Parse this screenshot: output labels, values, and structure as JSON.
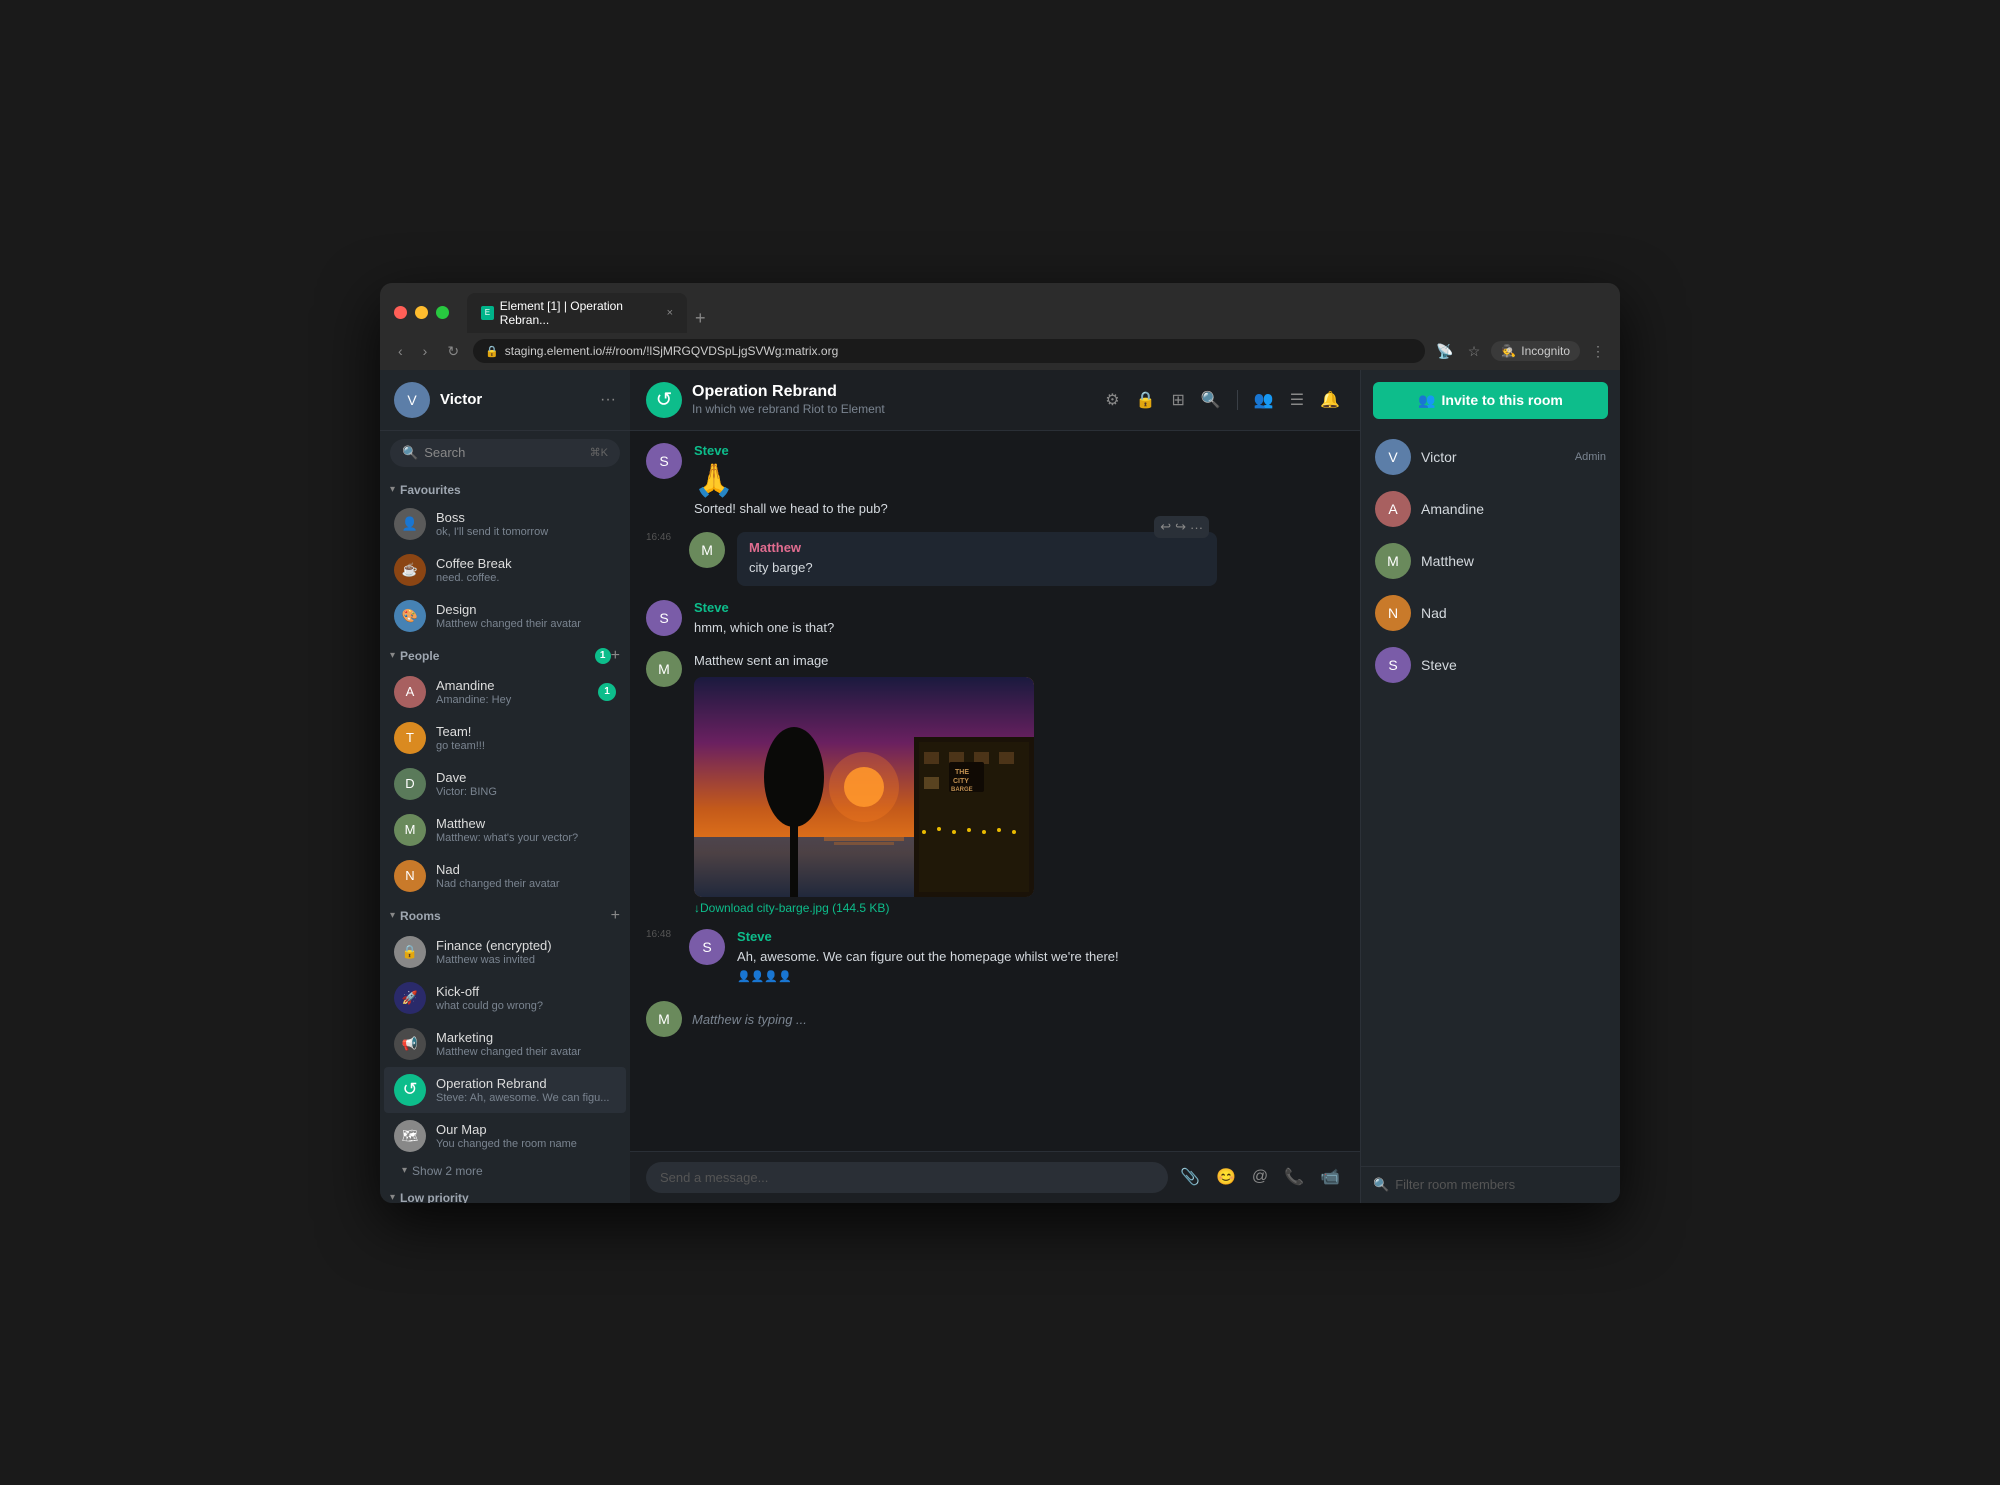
{
  "browser": {
    "tab_label": "Element [1] | Operation Rebran...",
    "tab_close": "×",
    "tab_new": "+",
    "nav_back": "‹",
    "nav_forward": "›",
    "nav_refresh": "↻",
    "address": "staging.element.io/#/room/!lSjMRGQVDSpLjgSVWg:matrix.org",
    "incognito_label": "Incognito",
    "incognito_icon": "🕵"
  },
  "sidebar": {
    "user_name": "Victor",
    "search_placeholder": "Search",
    "search_kbd": "⌘K",
    "sections": {
      "favourites_label": "Favourites",
      "people_label": "People",
      "rooms_label": "Rooms",
      "low_priority_label": "Low priority"
    },
    "favourites": [
      {
        "id": "boss",
        "name": "Boss",
        "preview": "ok, I'll send it tomorrow",
        "avatar_color": "av-boss"
      },
      {
        "id": "coffee-break",
        "name": "Coffee Break",
        "preview": "need. coffee.",
        "avatar_color": "av-coffee"
      },
      {
        "id": "design",
        "name": "Design",
        "preview": "Matthew changed their avatar",
        "avatar_color": "av-design"
      }
    ],
    "people": [
      {
        "id": "amandine",
        "name": "Amandine",
        "preview": "Amandine: Hey",
        "badge": "1",
        "avatar_color": "av-amandine"
      },
      {
        "id": "team",
        "name": "Team!",
        "preview": "go team!!!",
        "avatar_color": "av-team"
      },
      {
        "id": "dave",
        "name": "Dave",
        "preview": "Victor: BING",
        "avatar_color": "av-dave"
      },
      {
        "id": "matthew",
        "name": "Matthew",
        "preview": "Matthew: what's your vector?",
        "avatar_color": "av-matthew"
      },
      {
        "id": "nad",
        "name": "Nad",
        "preview": "Nad changed their avatar",
        "avatar_color": "av-nad"
      }
    ],
    "rooms": [
      {
        "id": "finance",
        "name": "Finance (encrypted)",
        "preview": "Matthew was invited",
        "avatar_color": "av-finance"
      },
      {
        "id": "kickoff",
        "name": "Kick-off",
        "preview": "what could go wrong?",
        "avatar_color": "av-kickoff"
      },
      {
        "id": "marketing",
        "name": "Marketing",
        "preview": "Matthew changed their avatar",
        "avatar_color": "av-marketing"
      },
      {
        "id": "operation-rebrand",
        "name": "Operation Rebrand",
        "preview": "Steve: Ah, awesome. We can figu...",
        "avatar_color": "av-oprebrand",
        "active": true
      },
      {
        "id": "our-map",
        "name": "Our Map",
        "preview": "You changed the room name",
        "avatar_color": "av-ourmap"
      }
    ],
    "show_more_label": "Show 2 more"
  },
  "chat": {
    "room_name": "Operation Rebrand",
    "room_topic": "In which we rebrand Riot to Element",
    "messages": [
      {
        "id": "msg1",
        "sender": "Steve",
        "sender_color": "green",
        "avatar_color": "av-steve",
        "text": "",
        "emoji": "🙏",
        "sub_text": "Sorted! shall we head to the pub?"
      },
      {
        "id": "msg2",
        "sender": "Matthew",
        "sender_color": "pink",
        "avatar_color": "av-matthew",
        "timestamp": "16:46",
        "text": "city barge?",
        "has_actions": true
      },
      {
        "id": "msg3",
        "sender": "Steve",
        "sender_color": "green",
        "avatar_color": "av-steve",
        "text": "hmm, which one is that?"
      },
      {
        "id": "msg4",
        "sender": "Matthew",
        "sender_color": "pink",
        "avatar_color": "av-matthew",
        "text": "Matthew sent an image",
        "has_image": true,
        "image_sign_line1": "THE",
        "image_sign_line2": "CITY",
        "image_sign_line3": "BARGE",
        "download_label": "↓Download city-barge.jpg (144.5 KB)"
      },
      {
        "id": "msg5",
        "sender": "Steve",
        "sender_color": "green",
        "avatar_color": "av-steve",
        "timestamp": "16:48",
        "text": "Ah, awesome. We can figure out the homepage whilst we're there!",
        "has_reactions": true
      }
    ],
    "typing_text": "Matthew is typing ...",
    "input_placeholder": "Send a message...",
    "action_reply": "↩",
    "action_quote": "↪",
    "action_more": "···"
  },
  "right_panel": {
    "invite_btn_label": "Invite to this room",
    "members": [
      {
        "id": "victor",
        "name": "Victor",
        "role": "Admin",
        "avatar_color": "av-victor"
      },
      {
        "id": "amandine",
        "name": "Amandine",
        "role": "",
        "avatar_color": "av-amandine"
      },
      {
        "id": "matthew",
        "name": "Matthew",
        "role": "",
        "avatar_color": "av-matthew"
      },
      {
        "id": "nad",
        "name": "Nad",
        "role": "",
        "avatar_color": "av-nad"
      },
      {
        "id": "steve",
        "name": "Steve",
        "role": "",
        "avatar_color": "av-steve"
      }
    ],
    "filter_placeholder": "Filter room members"
  }
}
